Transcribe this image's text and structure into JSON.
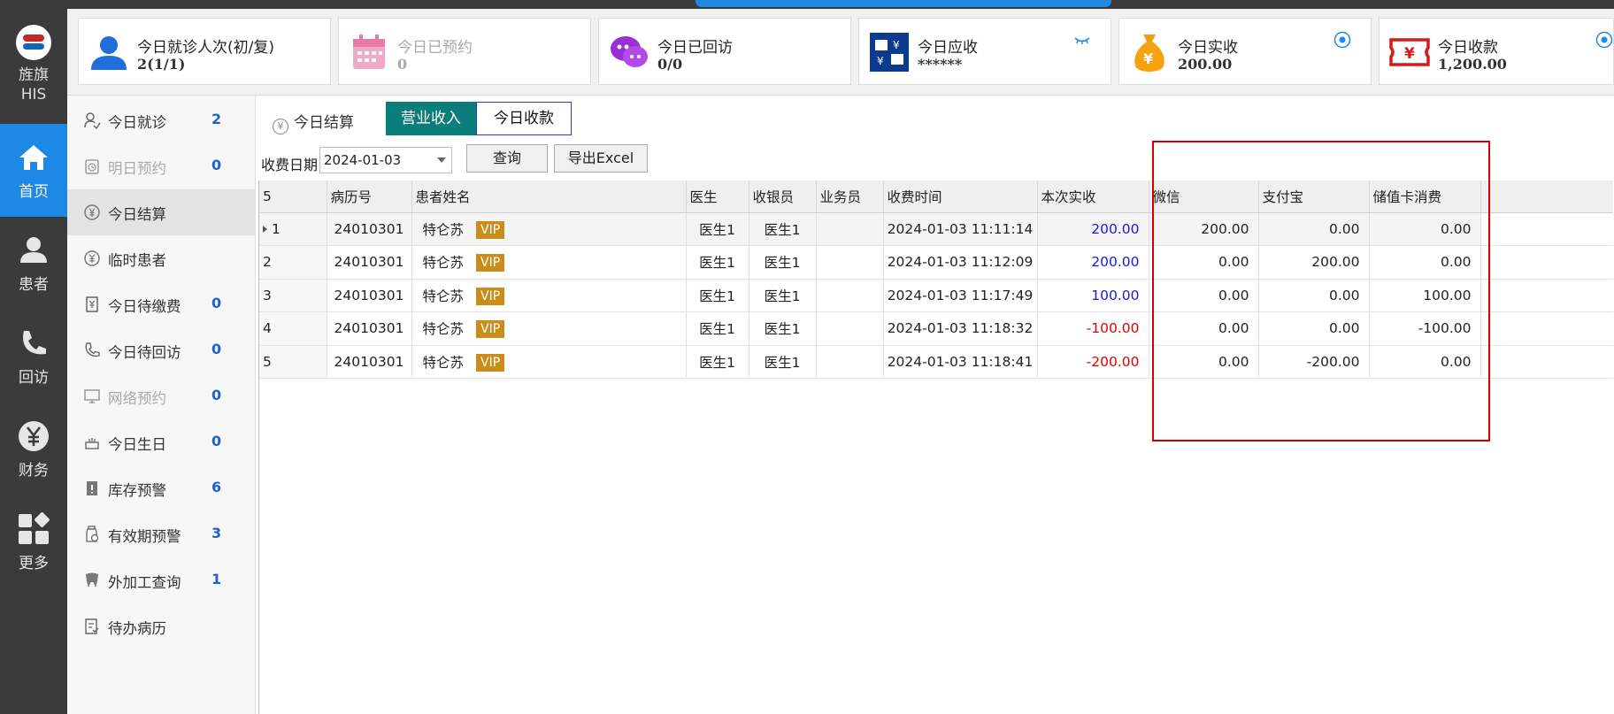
{
  "app": {
    "brand_line1": "旌旗",
    "brand_line2": "HIS"
  },
  "rail": [
    {
      "label": "首页",
      "icon": "home-icon"
    },
    {
      "label": "患者",
      "icon": "patient-icon"
    },
    {
      "label": "回访",
      "icon": "phone-icon"
    },
    {
      "label": "财务",
      "icon": "yuan-icon"
    },
    {
      "label": "更多",
      "icon": "more-grid-icon"
    }
  ],
  "cards": [
    {
      "title": "今日就诊人次(初/复)",
      "value": "2(1/1)",
      "icon": "user-icon"
    },
    {
      "title": "今日已预约",
      "value": "0",
      "icon": "calendar-icon"
    },
    {
      "title": "今日已回访",
      "value": "0/0",
      "icon": "chat-icon"
    },
    {
      "title": "今日应收",
      "value": "******",
      "icon": "receivable-icon"
    },
    {
      "title": "今日实收",
      "value": "200.00",
      "icon": "money-bag-icon"
    },
    {
      "title": "今日收款",
      "value": "1,200.00",
      "icon": "ticket-icon"
    }
  ],
  "menu": [
    {
      "label": "今日就诊",
      "count": "2",
      "icon": "visit-icon"
    },
    {
      "label": "明日预约",
      "count": "0",
      "icon": "clock-icon"
    },
    {
      "label": "今日结算",
      "count": "",
      "icon": "yuan-circle-icon"
    },
    {
      "label": "临时患者",
      "count": "",
      "icon": "yuan-circle-icon"
    },
    {
      "label": "今日待缴费",
      "count": "0",
      "icon": "bill-icon"
    },
    {
      "label": "今日待回访",
      "count": "0",
      "icon": "phone-icon"
    },
    {
      "label": "网络预约",
      "count": "0",
      "icon": "monitor-icon"
    },
    {
      "label": "今日生日",
      "count": "0",
      "icon": "cake-icon"
    },
    {
      "label": "库存预警",
      "count": "6",
      "icon": "warning-icon"
    },
    {
      "label": "有效期预警",
      "count": "3",
      "icon": "bottle-icon"
    },
    {
      "label": "外加工查询",
      "count": "1",
      "icon": "tooth-icon"
    },
    {
      "label": "待办病历",
      "count": "",
      "icon": "record-icon"
    }
  ],
  "page": {
    "crumb": "今日结算",
    "tab_income": "营业收入",
    "tab_receipts": "今日收款",
    "date_label": "收费日期",
    "date_value": "2024-01-03",
    "query_btn": "查询",
    "export_btn": "导出Excel"
  },
  "table": {
    "row_count": "5",
    "headers": [
      "病历号",
      "患者姓名",
      "医生",
      "收银员",
      "业务员",
      "收费时间",
      "本次实收",
      "微信",
      "支付宝",
      "储值卡消费"
    ],
    "vip": "VIP",
    "rows": [
      {
        "idx": "1",
        "record": "24010301",
        "name": "特仑苏",
        "doctor": "医生1",
        "cashier": "医生1",
        "sales": "",
        "time": "2024-01-03 11:11:14",
        "amount": "200.00",
        "wechat": "200.00",
        "alipay": "0.00",
        "card": "0.00"
      },
      {
        "idx": "2",
        "record": "24010301",
        "name": "特仑苏",
        "doctor": "医生1",
        "cashier": "医生1",
        "sales": "",
        "time": "2024-01-03 11:12:09",
        "amount": "200.00",
        "wechat": "0.00",
        "alipay": "200.00",
        "card": "0.00"
      },
      {
        "idx": "3",
        "record": "24010301",
        "name": "特仑苏",
        "doctor": "医生1",
        "cashier": "医生1",
        "sales": "",
        "time": "2024-01-03 11:17:49",
        "amount": "100.00",
        "wechat": "0.00",
        "alipay": "0.00",
        "card": "100.00"
      },
      {
        "idx": "4",
        "record": "24010301",
        "name": "特仑苏",
        "doctor": "医生1",
        "cashier": "医生1",
        "sales": "",
        "time": "2024-01-03 11:18:32",
        "amount": "-100.00",
        "wechat": "0.00",
        "alipay": "0.00",
        "card": "-100.00"
      },
      {
        "idx": "5",
        "record": "24010301",
        "name": "特仑苏",
        "doctor": "医生1",
        "cashier": "医生1",
        "sales": "",
        "time": "2024-01-03 11:18:41",
        "amount": "-200.00",
        "wechat": "0.00",
        "alipay": "-200.00",
        "card": "0.00"
      }
    ]
  },
  "colors": {
    "accent": "#1e88e5",
    "tab_active": "#0a7e7a",
    "vip": "#c88d1a",
    "negative": "#e00000",
    "positive": "#1a1ad4",
    "highlight_box": "#d40000"
  }
}
